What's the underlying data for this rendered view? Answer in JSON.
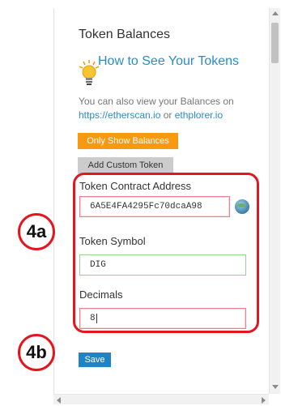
{
  "header": {
    "title": "Token Balances"
  },
  "help": {
    "heading": "How to See Your Tokens",
    "icon": "lightbulb-icon"
  },
  "description": {
    "text_before": "You can also view your Balances on",
    "link1": "https://etherscan.io",
    "connector": "or",
    "link2": "ethplorer.io"
  },
  "buttons": {
    "only_show_balances": "Only Show Balances",
    "add_custom_token": "Add Custom Token",
    "save": "Save"
  },
  "form": {
    "contract_address": {
      "label": "Token Contract Address",
      "value": "6A5E4FA4295Fc70dcaA98"
    },
    "symbol": {
      "label": "Token Symbol",
      "value": "DIG"
    },
    "decimals": {
      "label": "Decimals",
      "value": "8"
    }
  },
  "annotations": {
    "callout_a": "4a",
    "callout_b": "4b"
  },
  "footer": {
    "partial_text": "…"
  },
  "colors": {
    "accent_blue": "#2a8cc4",
    "orange": "#f79a12",
    "annotation_red": "#e5151f"
  }
}
